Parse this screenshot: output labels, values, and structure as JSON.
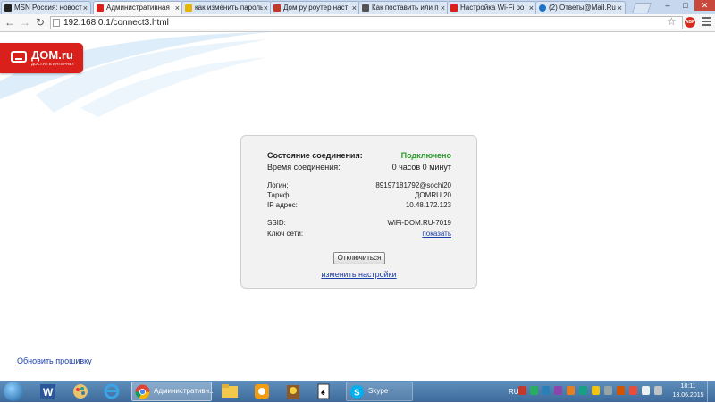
{
  "browser": {
    "tabs": [
      {
        "label": "MSN Россия: новост",
        "fav_color": "#222222",
        "active": false
      },
      {
        "label": "Административная",
        "fav_color": "#d9201b",
        "active": true
      },
      {
        "label": "как изменить пароль",
        "fav_color": "#e8b400",
        "active": false
      },
      {
        "label": "Дом ру роутер наст",
        "fav_color": "#c0392b",
        "active": false
      },
      {
        "label": "Как поставить или п",
        "fav_color": "#555555",
        "active": false
      },
      {
        "label": "Настройка Wi-Fi ро",
        "fav_color": "#d9201b",
        "active": false
      },
      {
        "label": "(2) Ответы@Mail.Ru",
        "fav_color": "#1a73c8",
        "active": false
      }
    ],
    "tab_close_glyph": "×",
    "window": {
      "min": "–",
      "max": "□",
      "close": "✕"
    },
    "nav": {
      "back": "←",
      "forward": "→",
      "reload": "↻"
    },
    "url": "192.168.0.1/connect3.html",
    "star": "☆",
    "abp": "ABP"
  },
  "logo": {
    "brand": "ДОМ.ru",
    "tagline": "ДОСТУП В ИНТЕРНЕТ",
    "color": "#d9201b"
  },
  "status": {
    "connection_label": "Состояние соединения:",
    "connection_value": "Подключено",
    "time_label": "Время соединения:",
    "time_value": "0 часов 0 минут",
    "login_label": "Логин:",
    "login_value": "89197181792@sochi20",
    "tariff_label": "Тариф:",
    "tariff_value": "ДОМRU.20",
    "ip_label": "IP адрес:",
    "ip_value": "10.48.172.123",
    "ssid_label": "SSID:",
    "ssid_value": "WiFi-DOM.RU-7019",
    "key_label": "Ключ сети:",
    "key_link": "показать",
    "disconnect_button": "Отключиться",
    "change_settings_link": "изменить настройки",
    "connected_color": "#2a9a2a"
  },
  "firmware_link": "Обновить прошивку",
  "taskbar": {
    "chrome_label": "Административн...",
    "skype_label": "Skype",
    "lang": "RU",
    "time": "18:11",
    "date": "13.06.2015",
    "icons": [
      "word-icon",
      "paint-icon",
      "ie-icon",
      "chrome-icon",
      "explorer-icon",
      "app-icon",
      "game-icon",
      "solitaire-icon",
      "skype-icon"
    ]
  }
}
